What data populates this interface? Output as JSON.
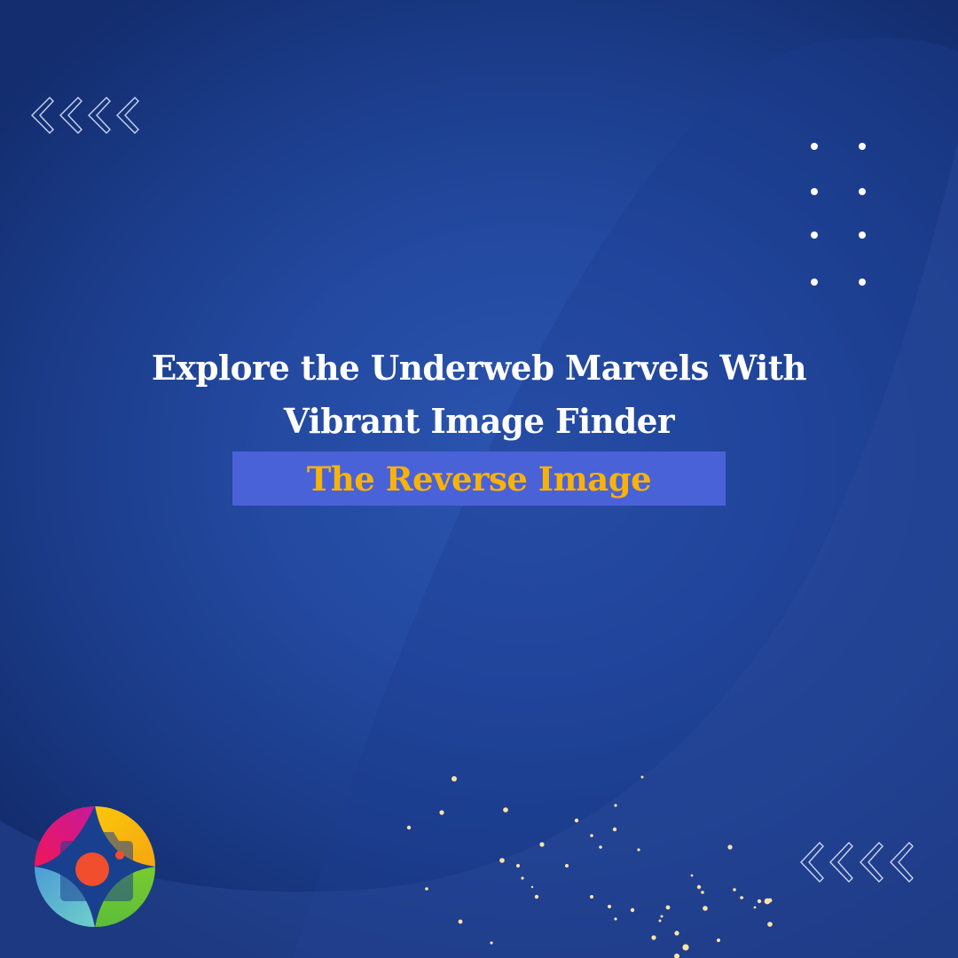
{
  "headline": {
    "line1": "Explore the Underweb Marvels With",
    "line2": "Vibrant Image Finder"
  },
  "subtitle": {
    "text": "The Reverse Image"
  },
  "colors": {
    "background": "#2349a0",
    "background_dark": "#132d6e",
    "headline_text": "#ffffff",
    "subtitle_box": "#4a62d8",
    "subtitle_text": "#f9b208",
    "sparkle": "#fde3a7"
  },
  "decorations": {
    "top_left": "chevron-left-group-icon",
    "top_right": "dot-grid-icon",
    "bottom_right": "chevron-left-group-icon",
    "bottom_left": "camera-location-logo",
    "bottom_center": "gold-sparkle-particles"
  },
  "logo": {
    "name": "camera-location-logo",
    "segment_colors": [
      "#e3187a",
      "#fbbf0a",
      "#6cc532",
      "#5ab3d6"
    ],
    "lens_color": "#f04e2c"
  }
}
